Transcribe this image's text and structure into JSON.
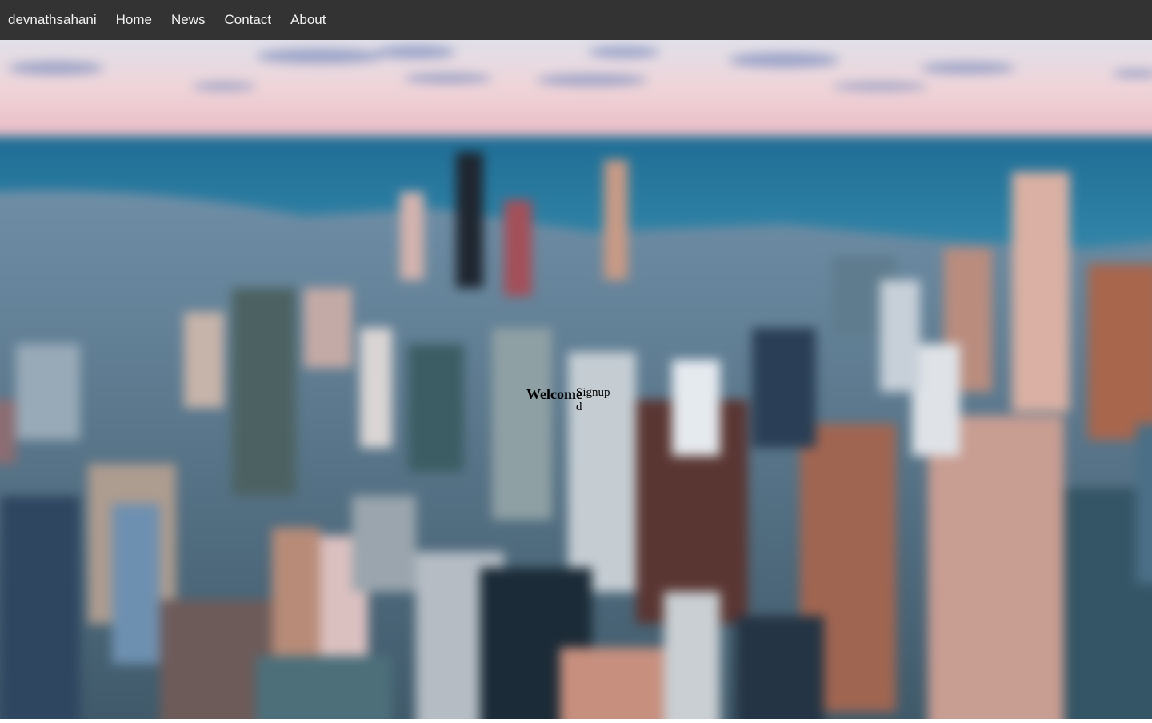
{
  "nav": {
    "brand": "devnathsahani",
    "items": [
      {
        "label": "Home"
      },
      {
        "label": "News"
      },
      {
        "label": "Contact"
      },
      {
        "label": "About"
      }
    ]
  },
  "hero": {
    "welcome": "Welcome",
    "signup": "Signupd",
    "background": "city-skyline-photo"
  },
  "colors": {
    "nav_bg": "#333333",
    "nav_text": "#f2f2f2",
    "sky_top": "#e9d9de",
    "water": "#2b7ca0"
  }
}
